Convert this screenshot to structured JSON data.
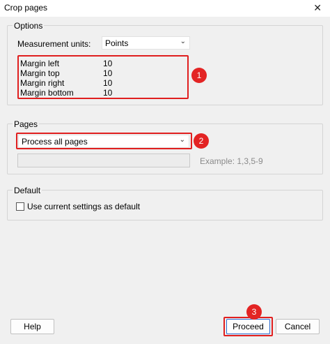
{
  "window": {
    "title": "Crop pages",
    "close_glyph": "✕"
  },
  "options": {
    "label": "Options",
    "units_label": "Measurement units:",
    "units_value": "Points",
    "margins": [
      {
        "label": "Margin left",
        "value": "10"
      },
      {
        "label": "Margin top",
        "value": "10"
      },
      {
        "label": "Margin right",
        "value": "10"
      },
      {
        "label": "Margin bottom",
        "value": "10"
      }
    ]
  },
  "pages": {
    "label": "Pages",
    "selected": "Process all pages",
    "range_value": "",
    "hint": "Example: 1,3,5-9"
  },
  "default": {
    "label": "Default",
    "checkbox_label": "Use current settings as default",
    "checked": false
  },
  "buttons": {
    "help": "Help",
    "proceed": "Proceed",
    "cancel": "Cancel"
  },
  "annotations": [
    "1",
    "2",
    "3"
  ],
  "colors": {
    "annotation_red": "#e32424",
    "primary_border": "#2a6ad0"
  },
  "icons": {
    "close": "close-icon",
    "dropdown": "chevron-down-icon"
  }
}
